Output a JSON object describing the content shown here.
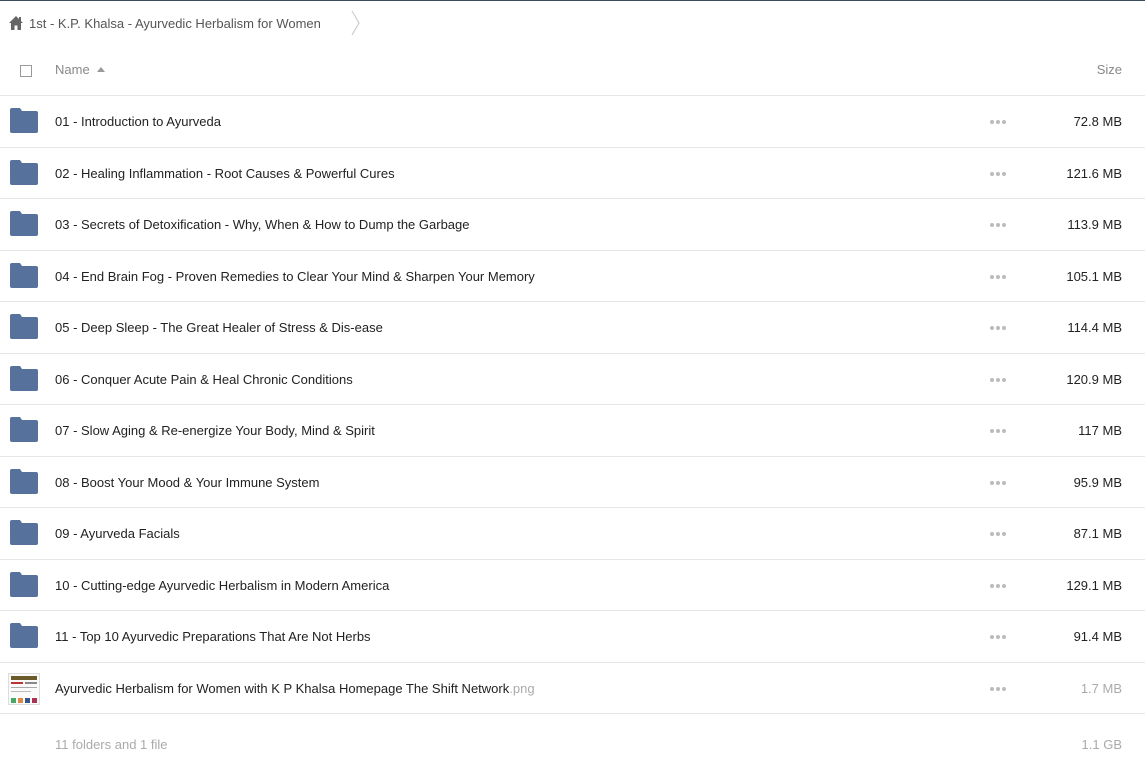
{
  "breadcrumb": {
    "icon": "home-icon",
    "label": "1st - K.P. Khalsa - Ayurvedic Herbalism for Women"
  },
  "table": {
    "columns": {
      "name": "Name",
      "size": "Size"
    },
    "sort": {
      "column": "Name",
      "direction": "ascending"
    },
    "folder_color": "#56729c",
    "rows": [
      {
        "type": "folder",
        "name": "01 - Introduction to Ayurveda",
        "size": "72.8 MB"
      },
      {
        "type": "folder",
        "name": "02 - Healing Inflammation - Root Causes & Powerful Cures",
        "size": "121.6 MB"
      },
      {
        "type": "folder",
        "name": "03 - Secrets of Detoxification - Why, When & How to Dump the Garbage",
        "size": "113.9 MB"
      },
      {
        "type": "folder",
        "name": "04 - End Brain Fog - Proven Remedies to Clear Your Mind & Sharpen Your Memory",
        "size": "105.1 MB"
      },
      {
        "type": "folder",
        "name": "05 - Deep Sleep - The Great Healer of Stress & Dis-ease",
        "size": "114.4 MB"
      },
      {
        "type": "folder",
        "name": "06 - Conquer Acute Pain & Heal Chronic Conditions",
        "size": "120.9 MB"
      },
      {
        "type": "folder",
        "name": "07 - Slow Aging & Re-energize Your Body, Mind & Spirit",
        "size": "117 MB"
      },
      {
        "type": "folder",
        "name": "08 - Boost Your Mood & Your Immune System",
        "size": "95.9 MB"
      },
      {
        "type": "folder",
        "name": "09 - Ayurveda Facials",
        "size": "87.1 MB"
      },
      {
        "type": "folder",
        "name": "10 - Cutting-edge Ayurvedic Herbalism in Modern America",
        "size": "129.1 MB"
      },
      {
        "type": "folder",
        "name": "11 - Top 10 Ayurvedic Preparations That Are Not Herbs",
        "size": "91.4 MB"
      },
      {
        "type": "file",
        "name": "Ayurvedic Herbalism for Women with K P Khalsa Homepage The Shift Network",
        "ext": ".png",
        "size": "1.7 MB"
      }
    ]
  },
  "footer": {
    "summary": "11 folders and 1 file",
    "total": "1.1 GB"
  }
}
